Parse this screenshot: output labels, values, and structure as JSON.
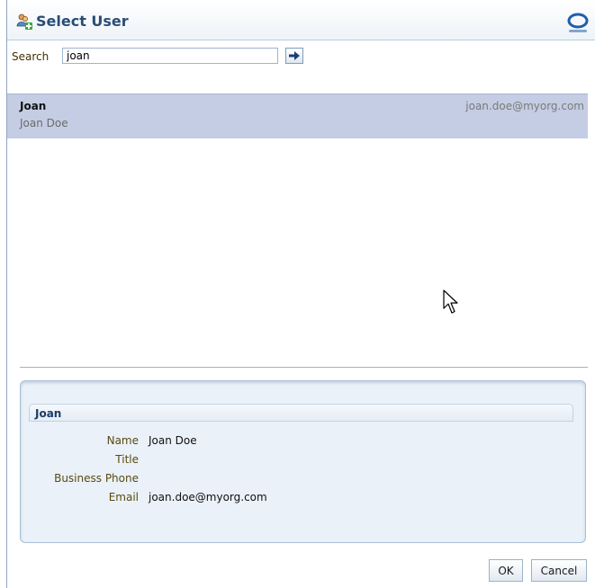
{
  "dialog": {
    "title": "Select User",
    "title_icon": "add-user-icon",
    "brand_icon": "oracle-logo-icon"
  },
  "search": {
    "label": "Search",
    "value": "joan",
    "go_icon": "arrow-right-icon"
  },
  "results": [
    {
      "name": "Joan",
      "full_name": "Joan Doe",
      "email": "joan.doe@myorg.com",
      "selected": true
    }
  ],
  "details": {
    "header": "Joan",
    "fields": [
      {
        "label": "Name",
        "value": "Joan Doe"
      },
      {
        "label": "Title",
        "value": ""
      },
      {
        "label": "Business Phone",
        "value": ""
      },
      {
        "label": "Email",
        "value": "joan.doe@myorg.com"
      }
    ]
  },
  "footer": {
    "ok_label": "OK",
    "cancel_label": "Cancel"
  },
  "colors": {
    "selected_row": "#c4cde3",
    "title": "#2a4d75",
    "label": "#5a4a10"
  }
}
